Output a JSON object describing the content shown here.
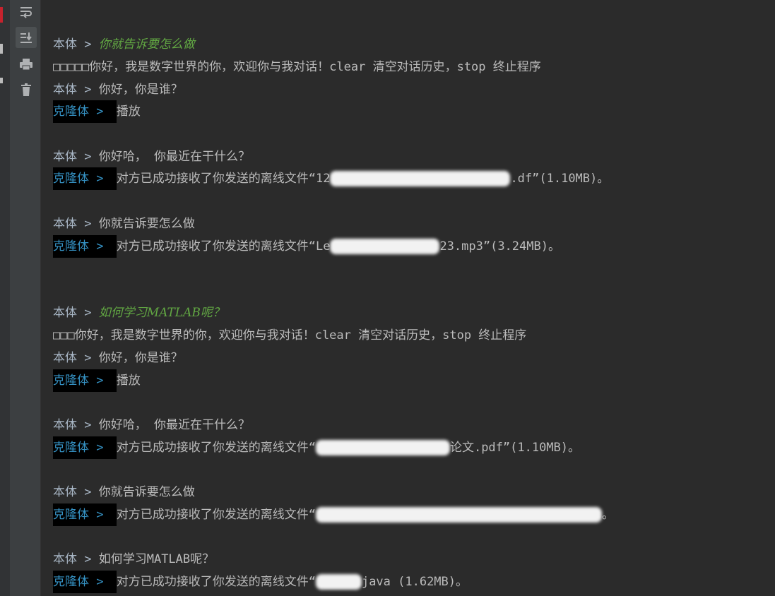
{
  "toolbar": {
    "buttons": [
      {
        "name": "soft-wrap-icon"
      },
      {
        "name": "scroll-to-end-icon"
      },
      {
        "name": "print-icon"
      },
      {
        "name": "trash-icon"
      }
    ]
  },
  "console": {
    "lines": [
      {
        "type": "echo",
        "prompt": "本体 > ",
        "text": "你就告诉要怎么做"
      },
      {
        "type": "plain",
        "text": "□□□□□你好，我是数字世界的你，欢迎你与我对话！clear 清空对话历史，stop 终止程序"
      },
      {
        "type": "self",
        "prompt": "本体 > ",
        "text": "你好，你是谁？"
      },
      {
        "type": "clone",
        "prompt": "克隆体 > ",
        "text": "播放"
      },
      {
        "type": "self",
        "prompt": "本体 > ",
        "text": "你好哈， 你最近在干什么？"
      },
      {
        "type": "clone",
        "prompt": "克隆体 > ",
        "text_before": "对方已成功接收了你发送的离线文件“12",
        "text_after": ".df”(1.10MB)。"
      },
      {
        "type": "self",
        "prompt": "本体 > ",
        "text": "你就告诉要怎么做"
      },
      {
        "type": "clone",
        "prompt": "克隆体 > ",
        "text_before": "对方已成功接收了你发送的离线文件“Le",
        "text_after": "23.mp3”(3.24MB)。"
      },
      {
        "type": "echo",
        "prompt": "本体 > ",
        "text": "如何学习MATLAB呢？"
      },
      {
        "type": "plain",
        "text": "□□□你好，我是数字世界的你，欢迎你与我对话！clear 清空对话历史，stop 终止程序"
      },
      {
        "type": "self",
        "prompt": "本体 > ",
        "text": "你好，你是谁？"
      },
      {
        "type": "clone",
        "prompt": "克隆体 > ",
        "text": "播放"
      },
      {
        "type": "self",
        "prompt": "本体 > ",
        "text": "你好哈， 你最近在干什么？"
      },
      {
        "type": "clone",
        "prompt": "克隆体 > ",
        "text_before": "对方已成功接收了你发送的离线文件“",
        "text_after": "论文.pdf”(1.10MB)。"
      },
      {
        "type": "self",
        "prompt": "本体 > ",
        "text": "你就告诉要怎么做"
      },
      {
        "type": "clone",
        "prompt": "克隆体 > ",
        "text_before": "对方已成功接收了你发送的离线文件“",
        "text_after": "。"
      },
      {
        "type": "self",
        "prompt": "本体 > ",
        "text": "如何学习MATLAB呢？"
      },
      {
        "type": "clone",
        "prompt": "克隆体 > ",
        "text_before": "对方已成功接收了你发送的离线文件“",
        "text_after": "java (1.62MB)。"
      }
    ]
  },
  "colors": {
    "background": "#2b2b2b",
    "toolbar": "#3c3f41",
    "text": "#bbbbbb",
    "clone_prompt": "#3592c4",
    "echo_input": "#62a843"
  }
}
